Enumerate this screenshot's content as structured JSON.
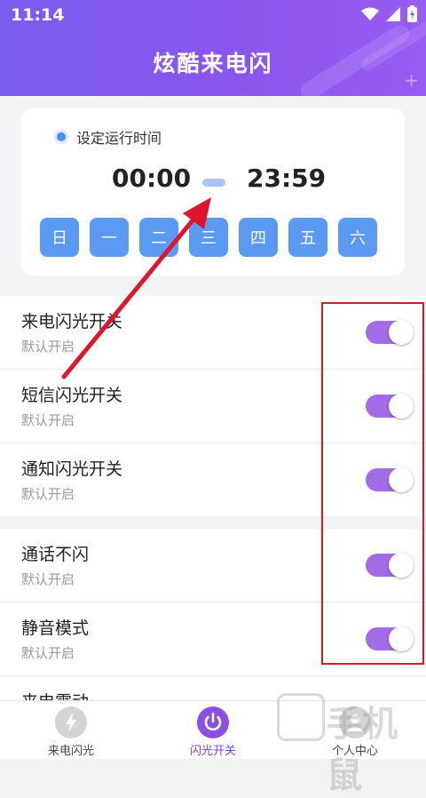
{
  "status": {
    "time": "11:14"
  },
  "header": {
    "title": "炫酷来电闪"
  },
  "schedule": {
    "label": "设定运行时间",
    "start": "00:00",
    "end": "23:59",
    "days": [
      "日",
      "一",
      "二",
      "三",
      "四",
      "五",
      "六"
    ]
  },
  "settings": [
    {
      "title": "来电闪光开关",
      "subtitle": "默认开启",
      "on": true
    },
    {
      "title": "短信闪光开关",
      "subtitle": "默认开启",
      "on": true
    },
    {
      "title": "通知闪光开关",
      "subtitle": "默认开启",
      "on": true
    },
    {
      "title": "通话不闪",
      "subtitle": "默认开启",
      "on": true
    },
    {
      "title": "静音模式",
      "subtitle": "默认开启",
      "on": true
    },
    {
      "title": "来电震动"
    }
  ],
  "tabs": [
    {
      "label": "来电闪光"
    },
    {
      "label": "闪光开关"
    },
    {
      "label": "个人中心"
    }
  ],
  "watermark": {
    "text": "手机鼠"
  },
  "colors": {
    "accent": "#7a5cf0",
    "toggle": "#a46be6",
    "day": "#5b9af2",
    "annotation": "#e0142a"
  }
}
